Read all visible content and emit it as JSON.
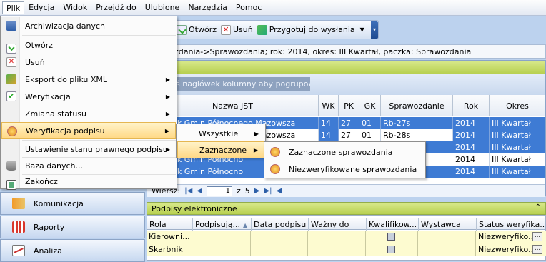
{
  "menubar": {
    "items": [
      "Plik",
      "Edycja",
      "Widok",
      "Przejdź do",
      "Ulubione",
      "Narzędzia",
      "Pomoc"
    ]
  },
  "toolbar": {
    "open_label": "Otwórz",
    "delete_label": "Usuń",
    "prepare_label": "Przygotuj do wysłania"
  },
  "path_text": "zdania->Sprawozdania; rok: 2014, okres: III Kwartał, paczka: Sprawozdania",
  "grid": {
    "group_hint": "ś nagłówek kolumny aby pogrupować",
    "columns": [
      "Nazwa JST",
      "WK",
      "PK",
      "GK",
      "Sprawozdanie",
      "Rok",
      "Okres"
    ],
    "rows": [
      [
        "Związek Gmin Północnego Mazowsza",
        "14",
        "27",
        "01",
        "Rb-27s",
        "2014",
        "III Kwartał"
      ],
      [
        "Związek Gmin Północnego Mazowsza",
        "14",
        "27",
        "01",
        "Rb-28s",
        "2014",
        "III Kwartał"
      ],
      [
        "",
        "",
        "",
        "",
        "",
        "2014",
        "III Kwartał"
      ],
      [
        "Związek Gmin Północno",
        "",
        "",
        "",
        "",
        "2014",
        "III Kwartał"
      ],
      [
        "Związek Gmin Północno",
        "",
        "",
        "",
        "",
        "2014",
        "III Kwartał"
      ]
    ]
  },
  "pager": {
    "label": "Wiersz:",
    "of_label": "z",
    "total": "5",
    "current": "1"
  },
  "nav": {
    "items": [
      "Komunikacja",
      "Raporty",
      "Analiza"
    ]
  },
  "signatures": {
    "title": "Podpisy elektroniczne",
    "columns": [
      "Rola",
      "Podpisują...",
      "Data podpisu",
      "Ważny do",
      "Kwalifikow...",
      "Wystawca",
      "Status weryfika..."
    ],
    "rows": [
      {
        "role": "Kierowni...",
        "status": "Niezweryfiko..."
      },
      {
        "role": "Skarbnik",
        "status": "Niezweryfiko..."
      }
    ]
  },
  "file_menu": {
    "items": [
      {
        "label": "Archiwizacja danych",
        "icon": "archive-icon"
      },
      {
        "label": "Otwórz",
        "icon": "open-icon"
      },
      {
        "label": "Usuń",
        "icon": "delete-icon"
      },
      {
        "label": "Eksport do pliku XML",
        "icon": "export-icon"
      },
      {
        "label": "Weryfikacja",
        "icon": "verify-icon"
      },
      {
        "label": "Zmiana statusu",
        "icon": ""
      },
      {
        "label": "Weryfikacja podpisu",
        "icon": "signature-icon"
      },
      {
        "label": "Ustawienie stanu prawnego podpisu",
        "icon": ""
      },
      {
        "label": "Baza danych...",
        "icon": "database-icon"
      },
      {
        "label": "Zakończ",
        "icon": "exit-icon"
      }
    ]
  },
  "submenu1": {
    "items": [
      "Wszystkie",
      "Zaznaczone"
    ]
  },
  "submenu2": {
    "items": [
      "Zaznaczone sprawozdania",
      "Niezweryfikowane sprawozdania"
    ]
  },
  "colors": {
    "selection": "#3e7bd4",
    "highlight": "#ffd885",
    "group_band": "#b8d050"
  }
}
